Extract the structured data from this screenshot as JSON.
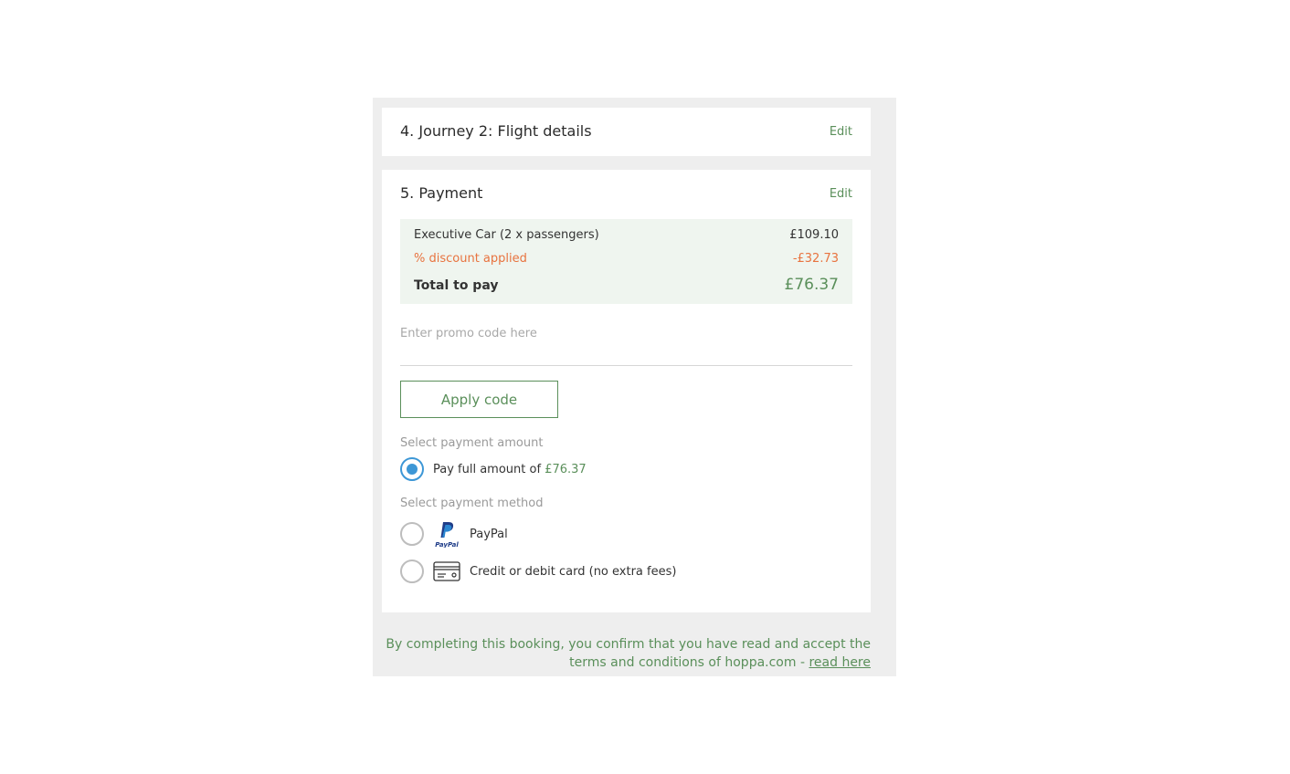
{
  "journey": {
    "title": "4. Journey 2: Flight details",
    "edit_label": "Edit"
  },
  "payment": {
    "title": "5. Payment",
    "edit_label": "Edit",
    "summary": {
      "item_label": "Executive Car (2 x passengers)",
      "item_price": "£109.10",
      "discount_label": "% discount applied",
      "discount_amount": "-£32.73",
      "total_label": "Total to pay",
      "total_amount": "£76.37"
    },
    "promo": {
      "placeholder": "Enter promo code here",
      "value": ""
    },
    "apply_button": "Apply code",
    "amount_section_label": "Select payment amount",
    "amount_option": {
      "text": "Pay full amount of",
      "price": "£76.37",
      "selected": true
    },
    "method_section_label": "Select payment method",
    "methods": [
      {
        "label": "PayPal",
        "icon": "paypal-icon",
        "selected": false
      },
      {
        "label": "Credit or debit card (no extra fees)",
        "icon": "credit-card-icon",
        "selected": false
      }
    ]
  },
  "terms": {
    "text": "By completing this booking, you confirm that you have read and accept the terms and conditions of hoppa.com - ",
    "link": "read here"
  },
  "colors": {
    "accent_green": "#5a8f5a",
    "discount_orange": "#e8733f",
    "radio_blue": "#3d97d6",
    "summary_bg": "#eff5ef",
    "panel_bg": "#eeeeee"
  }
}
